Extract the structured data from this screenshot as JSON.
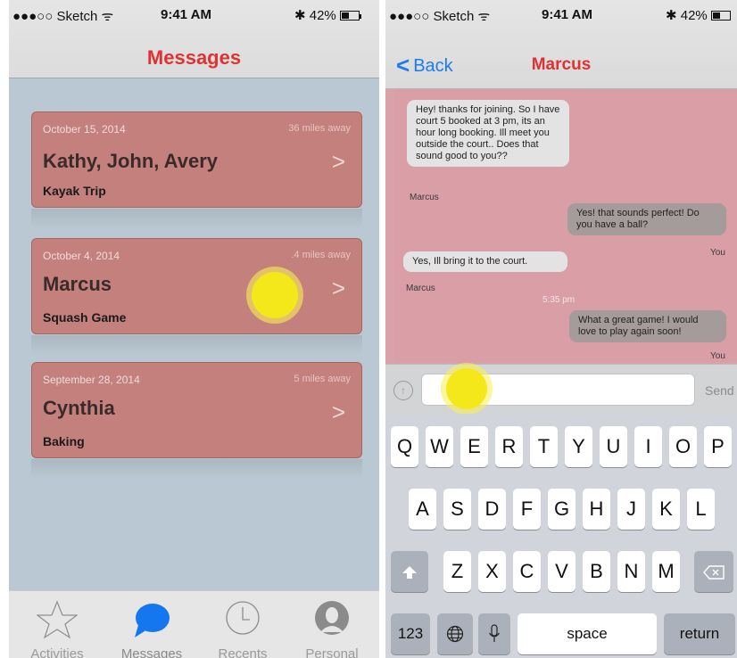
{
  "left": {
    "status": {
      "carrier": "●●●○○ Sketch ᯤ",
      "time": "9:41 AM",
      "battery": "✱ 42%"
    },
    "title": "Messages",
    "cards": [
      {
        "date": "October 15, 2014",
        "distance": "36  miles away",
        "name": "Kathy, John, Avery",
        "subtitle": "Kayak Trip"
      },
      {
        "date": "October 4, 2014",
        "distance": ".4  miles away",
        "name": "Marcus",
        "subtitle": "Squash Game"
      },
      {
        "date": "September 28, 2014",
        "distance": "5  miles away",
        "name": "Cynthia",
        "subtitle": "Baking"
      }
    ],
    "tabs": [
      {
        "label": "Activities",
        "icon": "star-icon"
      },
      {
        "label": "Messages",
        "icon": "chat-bubble-icon"
      },
      {
        "label": "Recents",
        "icon": "clock-icon"
      },
      {
        "label": "Personal",
        "icon": "person-icon"
      }
    ]
  },
  "right": {
    "status": {
      "carrier": "●●●○○ Sketch ᯤ",
      "time": "9:41 AM",
      "battery": "✱ 42%"
    },
    "back_label": "Back",
    "title": "Marcus",
    "messages": [
      {
        "from": "Marcus",
        "text": "Hey! thanks for joining. So I have court 5 booked at 3 pm, its an hour long booking. Ill meet you outside the court.. Does that sound good to you??"
      },
      {
        "from": "You",
        "text": "Yes! that sounds perfect! Do you have a ball?"
      },
      {
        "from": "Marcus",
        "text": "Yes, Ill bring it to the court."
      },
      {
        "from": "You",
        "text": "What a great game! I would love to play again soon!"
      }
    ],
    "timestamp": "5:35 pm",
    "input": {
      "placeholder": "",
      "value": "",
      "send_label": "Send"
    },
    "keyboard": {
      "row1": [
        "Q",
        "W",
        "E",
        "R",
        "T",
        "Y",
        "U",
        "I",
        "O",
        "P"
      ],
      "row2": [
        "A",
        "S",
        "D",
        "F",
        "G",
        "H",
        "J",
        "K",
        "L"
      ],
      "row3": [
        "Z",
        "X",
        "C",
        "V",
        "B",
        "N",
        "M"
      ],
      "numbers_label": "123",
      "space_label": "space",
      "return_label": "return"
    }
  },
  "colors": {
    "accent_red": "#e03232",
    "link_blue": "#1a7cf0",
    "card": "#c4807c",
    "tap_indicator": "#f5e81a"
  }
}
